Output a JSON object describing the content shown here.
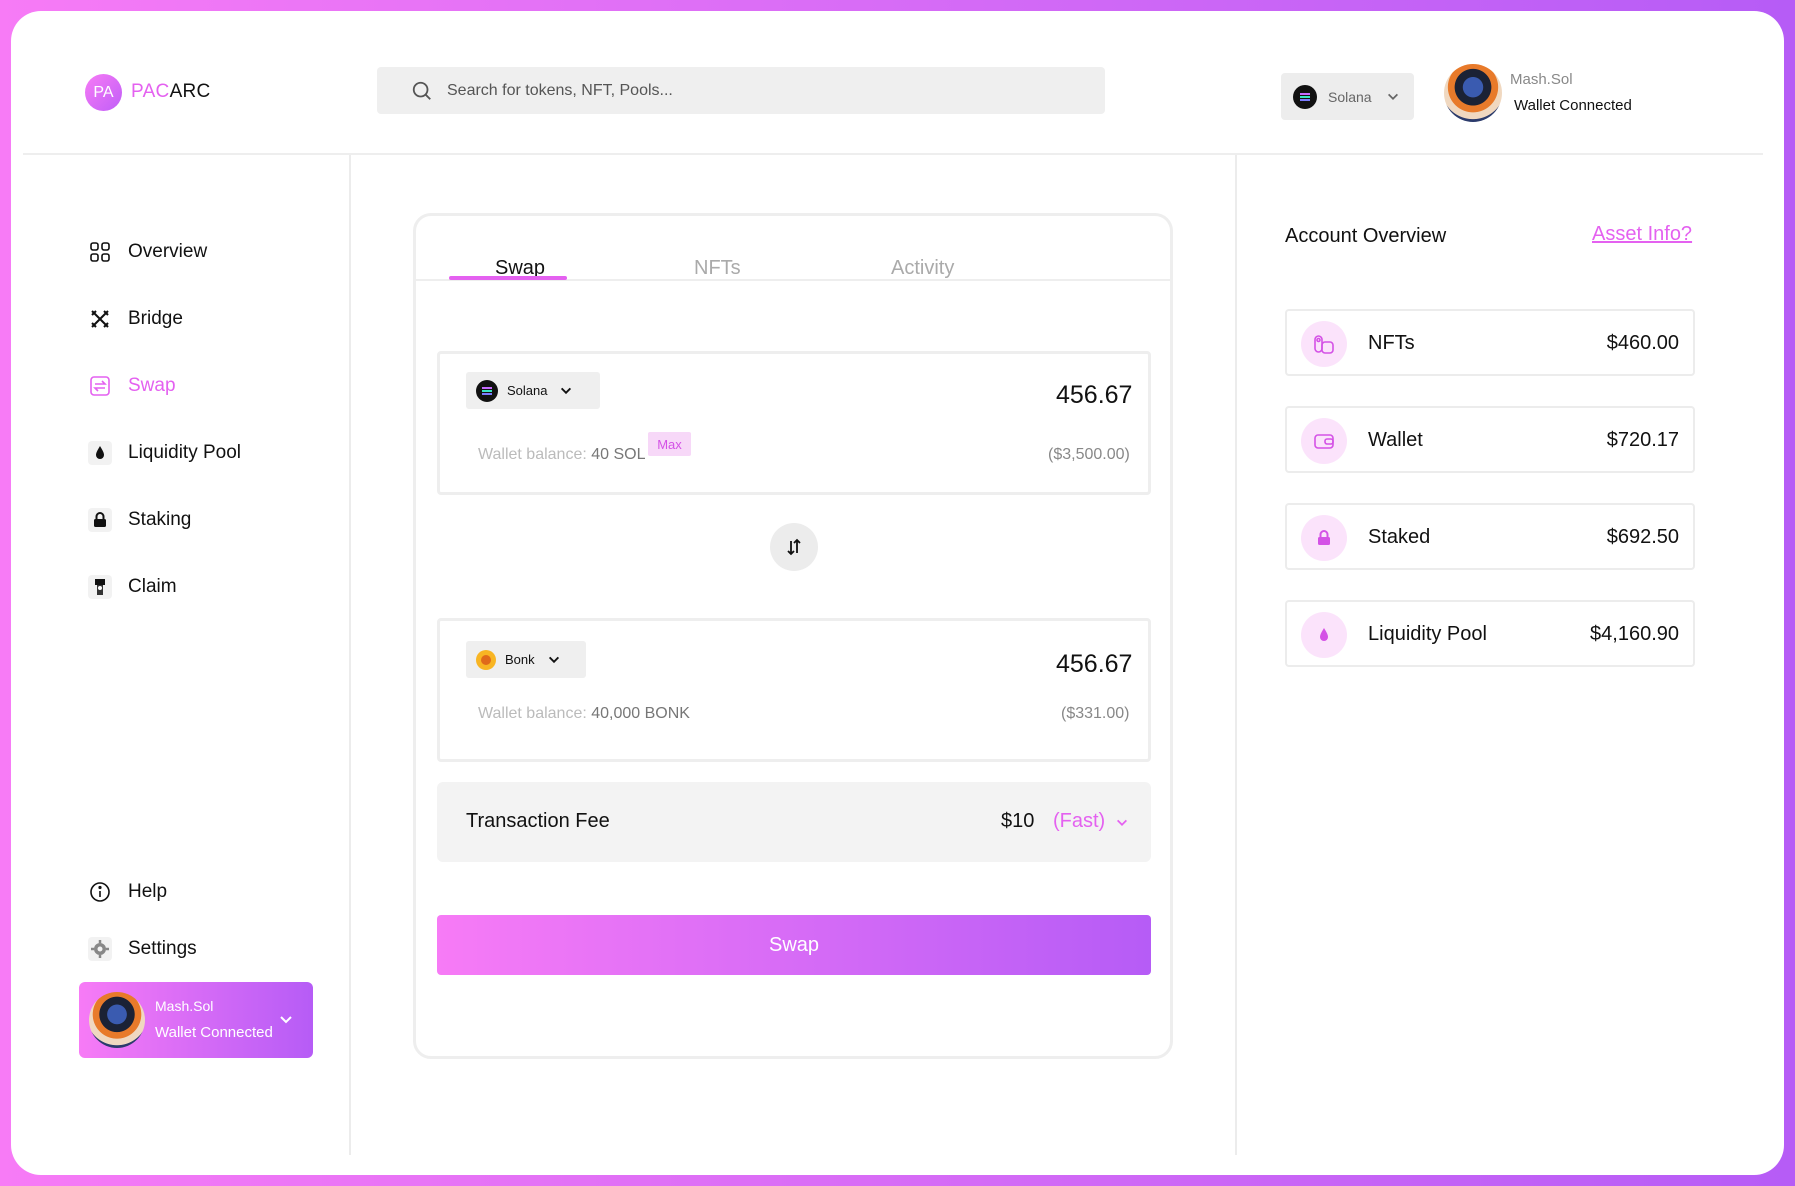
{
  "header": {
    "logo_initials": "PA",
    "logo_part1": "PAC",
    "logo_part2": "ARC",
    "search_placeholder": "Search for tokens, NFT, Pools...",
    "network": "Solana",
    "user_name": "Mash.Sol",
    "user_status": "Wallet Connected"
  },
  "sidebar": {
    "items": [
      {
        "label": "Overview",
        "icon": "grid-icon"
      },
      {
        "label": "Bridge",
        "icon": "bridge-icon"
      },
      {
        "label": "Swap",
        "icon": "swap-icon",
        "active": true
      },
      {
        "label": "Liquidity Pool",
        "icon": "drop-icon"
      },
      {
        "label": "Staking",
        "icon": "lock-icon"
      },
      {
        "label": "Claim",
        "icon": "claim-icon"
      }
    ],
    "bottom": [
      {
        "label": "Help",
        "icon": "info-icon"
      },
      {
        "label": "Settings",
        "icon": "gear-icon"
      }
    ],
    "user_name": "Mash.Sol",
    "user_status": "Wallet Connected"
  },
  "swap_card": {
    "tabs": [
      "Swap",
      "NFTs",
      "Activity"
    ],
    "active_tab": "Swap",
    "from": {
      "token": "Solana",
      "amount": "456.67",
      "balance_label": "Wallet balance:",
      "balance_value": "40 SOL",
      "max_label": "Max",
      "usd": "($3,500.00)"
    },
    "to": {
      "token": "Bonk",
      "amount": "456.67",
      "balance_label": "Wallet balance:",
      "balance_value": "40,000 BONK",
      "usd": "($331.00)"
    },
    "fee": {
      "label": "Transaction Fee",
      "value": "$10",
      "speed": "(Fast)"
    },
    "swap_button": "Swap"
  },
  "account": {
    "title": "Account Overview",
    "link": "Asset Info?",
    "rows": [
      {
        "label": "NFTs",
        "value": "$460.00",
        "icon": "nft-icon"
      },
      {
        "label": "Wallet",
        "value": "$720.17",
        "icon": "wallet-icon"
      },
      {
        "label": "Staked",
        "value": "$692.50",
        "icon": "lock-icon"
      },
      {
        "label": "Liquidity Pool",
        "value": "$4,160.90",
        "icon": "drop-icon"
      }
    ]
  },
  "colors": {
    "accent": "#e461f0",
    "gradient_start": "#f77bf6",
    "gradient_end": "#b65cf6"
  }
}
